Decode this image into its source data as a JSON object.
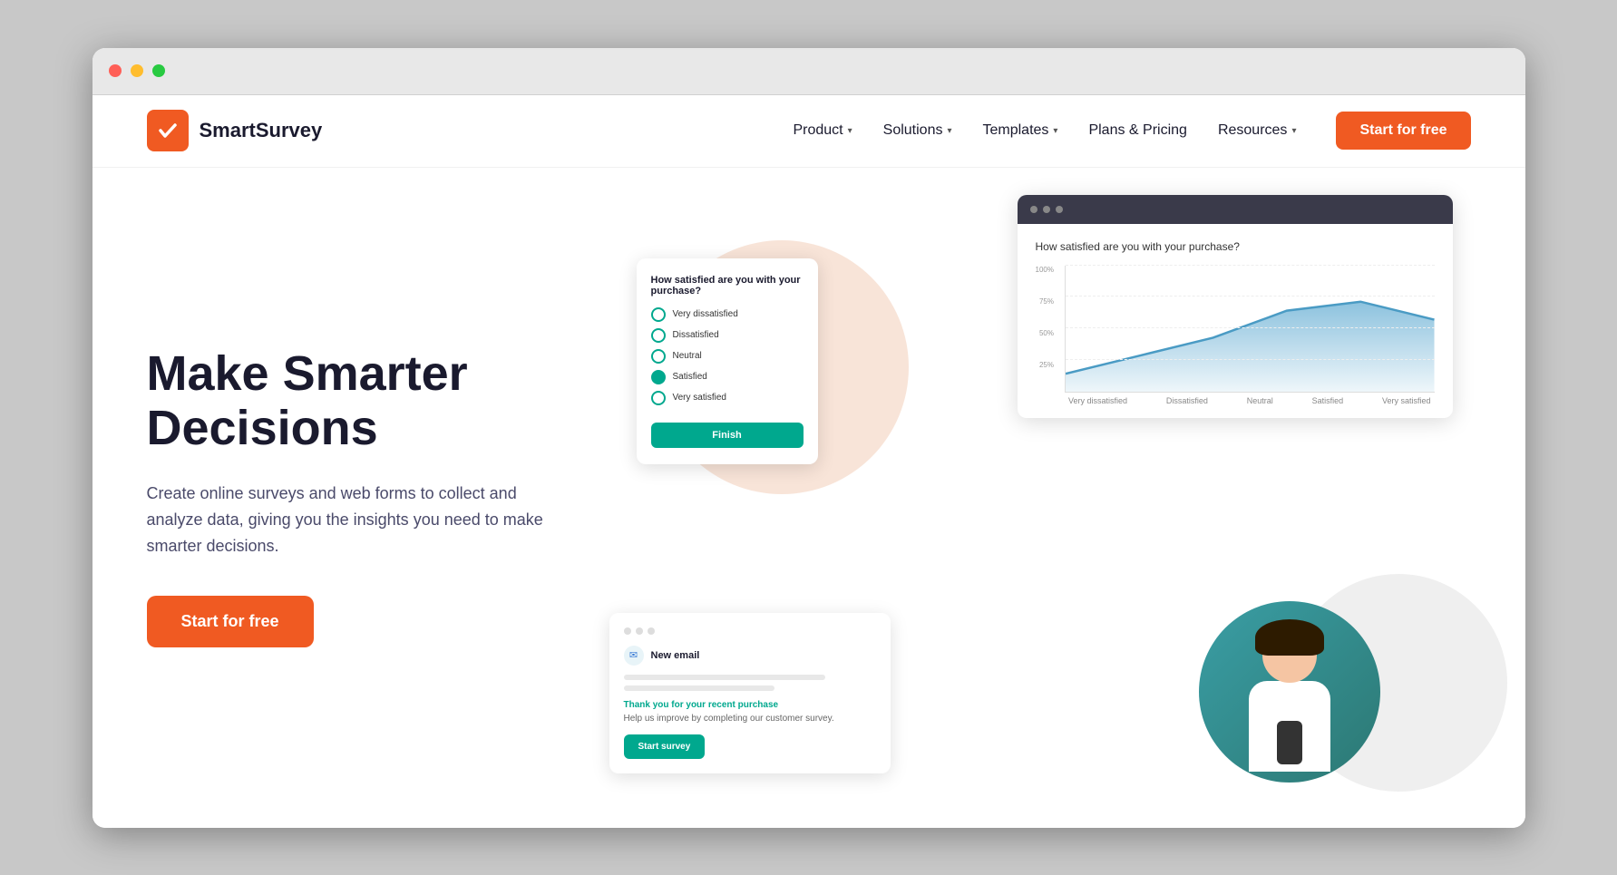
{
  "browser": {
    "traffic_lights": [
      "red",
      "yellow",
      "green"
    ]
  },
  "navbar": {
    "logo_text": "SmartSurvey",
    "nav_items": [
      {
        "label": "Product",
        "has_dropdown": true
      },
      {
        "label": "Solutions",
        "has_dropdown": true
      },
      {
        "label": "Templates",
        "has_dropdown": true
      },
      {
        "label": "Plans & Pricing",
        "has_dropdown": false
      },
      {
        "label": "Resources",
        "has_dropdown": true
      }
    ],
    "cta_label": "Start for free"
  },
  "hero": {
    "heading": "Make Smarter Decisions",
    "subtext": "Create online surveys and web forms to collect and analyze data, giving you the insights you need to make smarter decisions.",
    "cta_label": "Start for free"
  },
  "survey_card": {
    "question": "How satisfied are you with your purchase?",
    "options": [
      {
        "label": "Very dissatisfied"
      },
      {
        "label": "Dissatisfied"
      },
      {
        "label": "Neutral"
      },
      {
        "label": "Satisfied"
      },
      {
        "label": "Very satisfied"
      }
    ],
    "finish_btn": "Finish"
  },
  "chart": {
    "question": "How satisfied are you with your purchase?",
    "y_labels": [
      "100%",
      "75%",
      "50%",
      "25%"
    ],
    "x_labels": [
      "Very dissatisfied",
      "Dissatisfied",
      "Neutral",
      "Satisfied",
      "Very satisfied"
    ]
  },
  "email_card": {
    "subject": "New email",
    "thank_text": "Thank you for your recent purchase",
    "body_text": "Help us improve by completing our customer survey.",
    "survey_btn": "Start survey"
  }
}
